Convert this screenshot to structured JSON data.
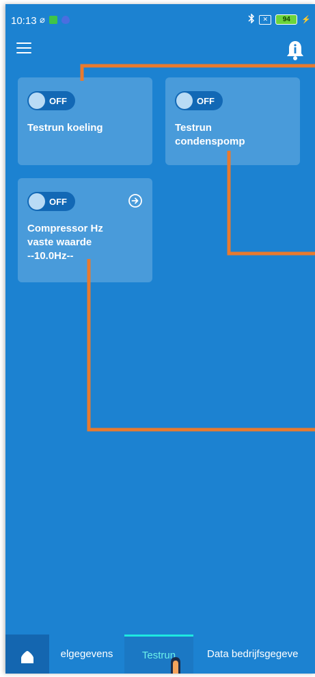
{
  "status_bar": {
    "time": "10:13",
    "battery": "94",
    "icons": [
      "wifi-off-icon",
      "app-notification-icon",
      "shield-icon",
      "bluetooth-icon",
      "no-sim-icon",
      "battery-icon",
      "charging-icon"
    ]
  },
  "app_bar": {
    "menu_icon": "hamburger-menu-icon",
    "bell_icon": "notification-bell-icon"
  },
  "cards": [
    {
      "toggle_state": "OFF",
      "title": "Testrun koeling"
    },
    {
      "toggle_state": "OFF",
      "title": "Testrun\ncondenspomp"
    },
    {
      "toggle_state": "OFF",
      "title": "Compressor Hz\nvaste waarde\n--10.0Hz--",
      "has_arrow": true
    }
  ],
  "tabs": {
    "home_icon": "home-icon",
    "items": [
      "elgegevens",
      "Testrun",
      "Data bedrijfsgegeve"
    ],
    "active": "Testrun"
  },
  "colors": {
    "background": "#1c82d1",
    "annotation": "#e87a2e",
    "active_tab": "#1ee8e0"
  }
}
